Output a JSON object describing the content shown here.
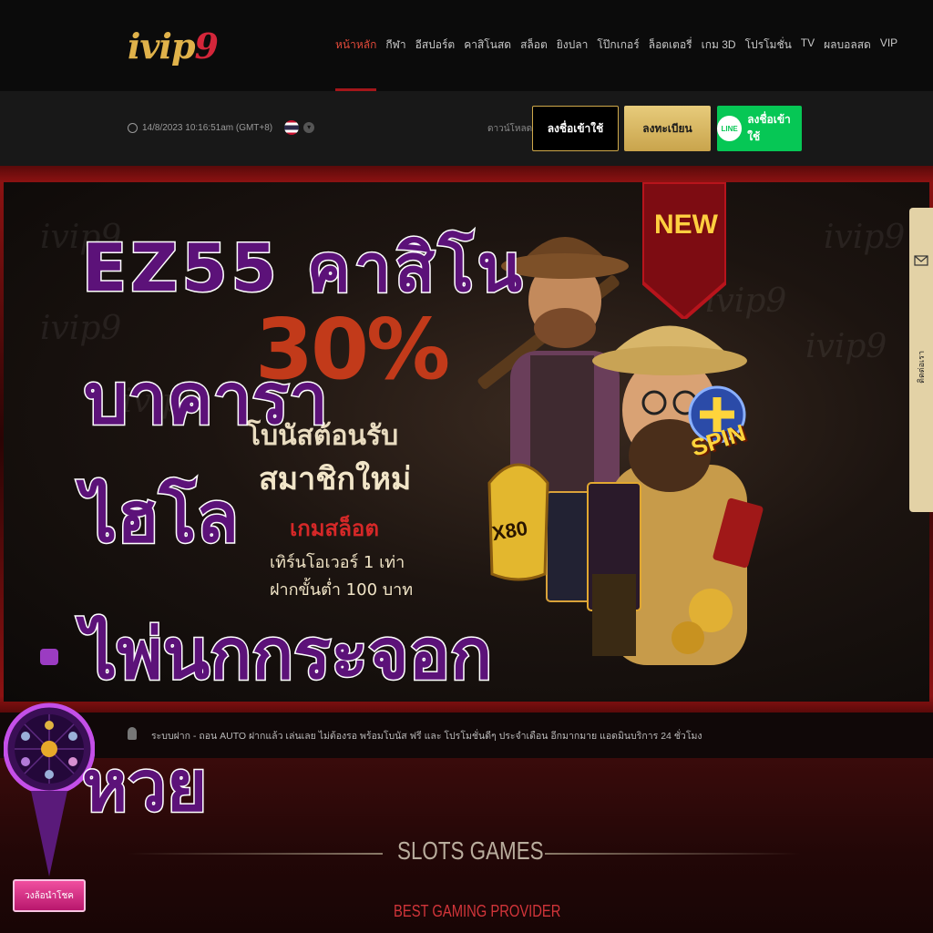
{
  "header": {
    "logo_main": "ivip",
    "logo_accent": "9",
    "nav": [
      "หน้าหลัก",
      "กีฬา",
      "อีสปอร์ต",
      "คาสิโนสด",
      "สล็อต",
      "ยิงปลา",
      "โป๊กเกอร์",
      "ล็อตเตอรี่",
      "เกม 3D",
      "โปรโมชั่น",
      "TV",
      "ผลบอลสด",
      "VIP"
    ],
    "active_index": 0
  },
  "subbar": {
    "datetime": "14/8/2023 10:16:51am (GMT+8)",
    "download_label": "ดาวน์โหลด",
    "login_label": "ลงชื่อเข้าใช้",
    "register_label": "ลงทะเบียน",
    "line_badge": "LINE",
    "line_login_label": "ลงชื่อเข้าใช้"
  },
  "banner": {
    "watermark": "ivip9",
    "promo_percent": "30%",
    "promo_line1": "โบนัสต้อนรับ",
    "promo_line2": "สมาชิกใหม่",
    "promo_line3": "เกมสล็อต",
    "promo_line4": "เทิร์นโอเวอร์ 1 เท่า",
    "promo_line5": "ฝากขั้นต่ำ 100 บาท",
    "new_badge": "NEW",
    "spin_badge": "SPIN",
    "multiplier": "X80"
  },
  "contact_tab": {
    "label": "ติดต่อเรา"
  },
  "ticker": {
    "text": "ระบบฝาก - ถอน AUTO  ฝากแล้ว เล่นเลย ไม่ต้องรอ พร้อมโบนัส ฟรี และ โปรโมชั่นดีๆ ประจำเดือน อีกมากมาย แอดมินบริการ 24 ชั่วโมง"
  },
  "section": {
    "title": "SLOTS GAMES",
    "subtitle": "BEST GAMING PROVIDER"
  },
  "lucky_wheel": {
    "label": "วงล้อนำโชค"
  },
  "overlay_headline": [
    "EZ55 คาสิโน",
    "บาคารา",
    "ไฮโล",
    "ไพ่นกกระจอก",
    "หวย"
  ],
  "colors": {
    "headline": "#5c1279",
    "accent_red": "#a4161a",
    "gold": "#cfa94a",
    "line_green": "#06c755"
  }
}
